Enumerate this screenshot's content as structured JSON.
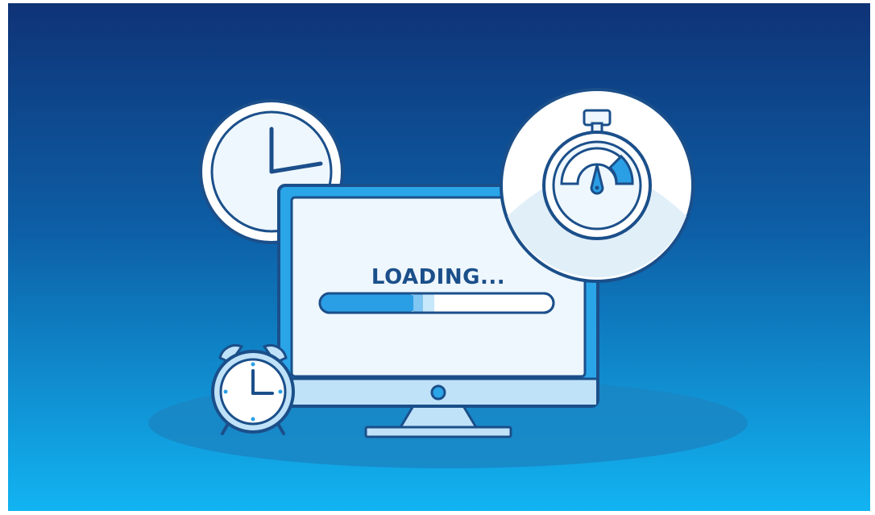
{
  "screen": {
    "status_text": "LOADING...",
    "progress": 0.42
  },
  "colors": {
    "background_top": "#0f3377",
    "background_bottom": "#12b4f2",
    "outline": "#1b4f8a",
    "screen_bg": "#eef7fd",
    "monitor_bezel": "#2aa5e8",
    "accent_blue": "#2b9fe6",
    "light_blue": "#bfe2f8",
    "floor_shadow": "#1a86c4"
  },
  "icons": {
    "wall_clock": "clock-icon",
    "alarm_clock": "alarm-clock-icon",
    "stopwatch": "stopwatch-icon",
    "monitor": "monitor-icon"
  }
}
